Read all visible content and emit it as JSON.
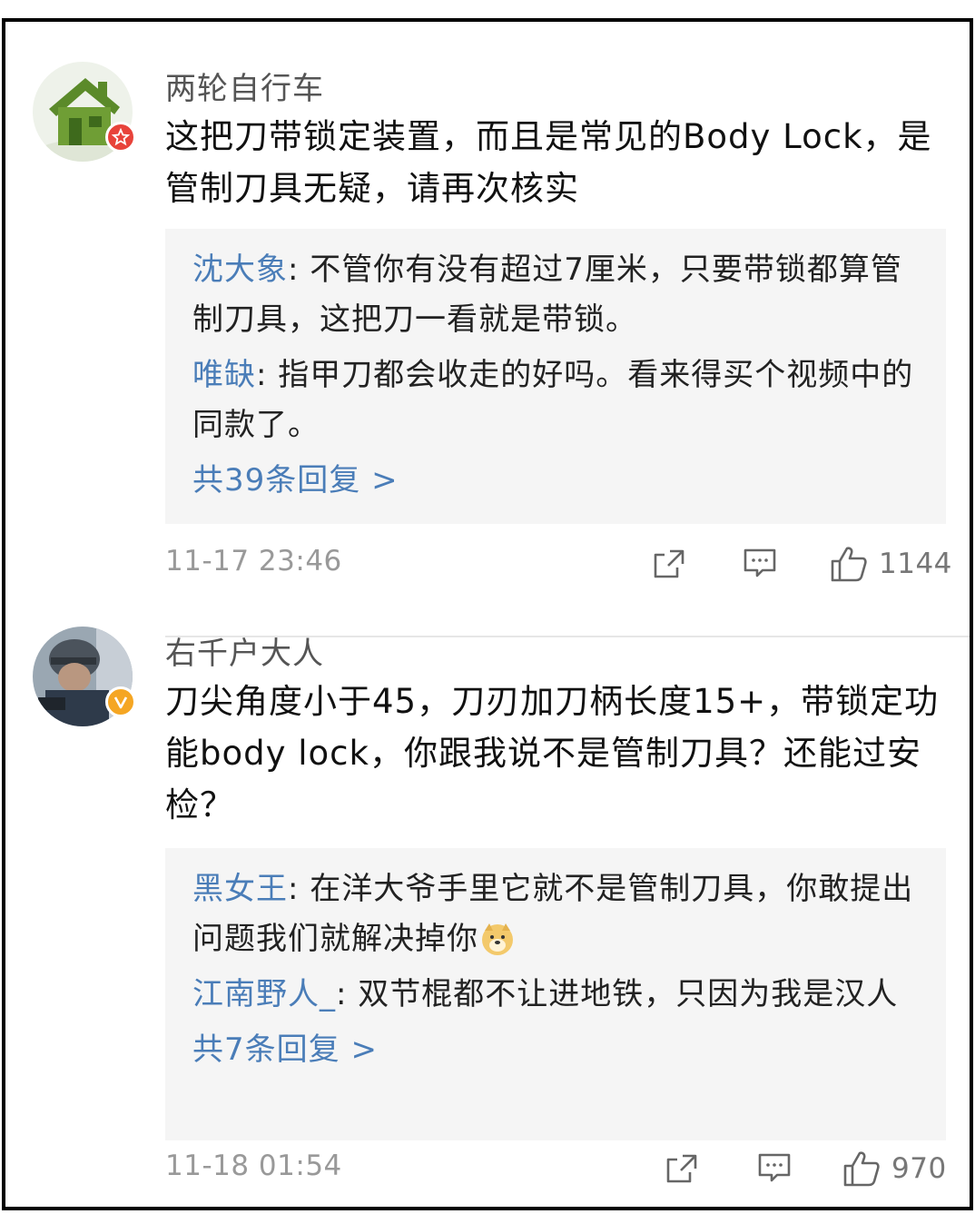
{
  "header_partial": "",
  "comments": [
    {
      "username": "两轮自行车",
      "badge": "red",
      "text": "这把刀带锁定装置，而且是常见的Body Lock，是管制刀具无疑，请再次核实",
      "replies": [
        {
          "name": "沈大象",
          "text": ": 不管你有没有超过7厘米，只要带锁都算管制刀具，这把刀一看就是带锁。"
        },
        {
          "name": "唯缺",
          "text": ": 指甲刀都会收走的好吗。看来得买个视频中的同款了。"
        }
      ],
      "more_replies": "共39条回复 >",
      "timestamp": "11-17 23:46",
      "likes": "1144"
    },
    {
      "username": "右千户大人",
      "badge": "yellow",
      "text": "刀尖角度小于45，刀刃加刀柄长度15+，带锁定功能body lock，你跟我说不是管制刀具？还能过安检？",
      "replies": [
        {
          "name": "黑女王",
          "text": ": 在洋大爷手里它就不是管制刀具，你敢提出问题我们就解决掉你"
        },
        {
          "name": "江南野人_",
          "text": ": 双节棍都不让进地铁，只因为我是汉人"
        }
      ],
      "more_replies": "共7条回复 >",
      "timestamp": "11-18 01:54",
      "likes": "970"
    }
  ],
  "colors": {
    "reply_name": "#4a7db8",
    "reply_bg": "#f5f5f5",
    "meta_text": "#999999",
    "badge_red": "#e8433a",
    "badge_yellow": "#f5a623"
  },
  "icons": {
    "share": "share-icon",
    "comment": "comment-icon",
    "like": "thumbs-up-icon",
    "emoji": "doge-emoji-icon"
  }
}
